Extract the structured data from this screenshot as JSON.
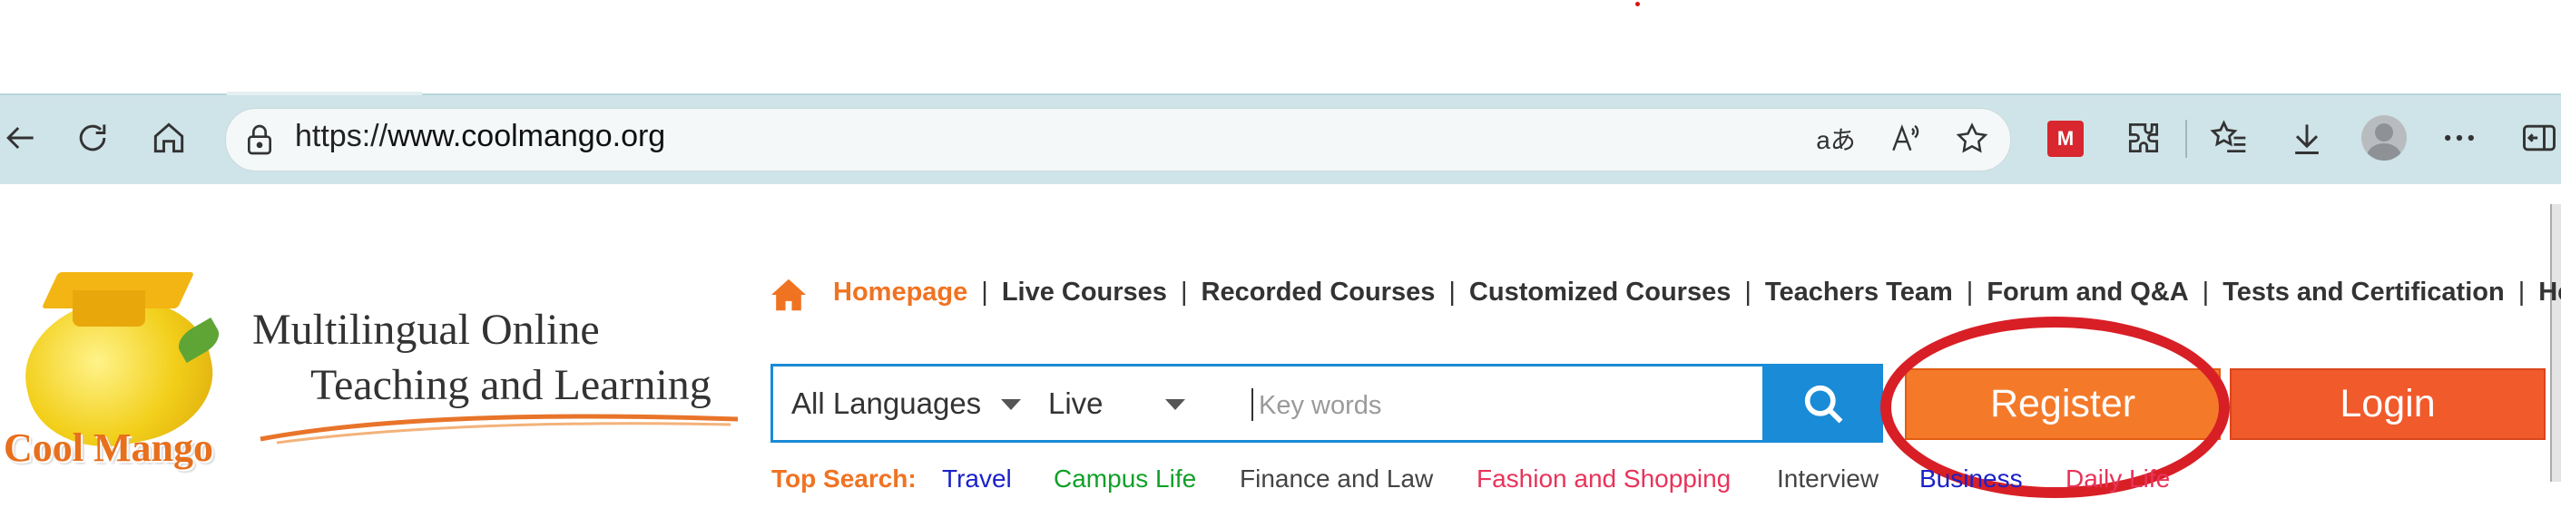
{
  "browser": {
    "url_prefix": "https://",
    "url_domain": "www.coolmango.org",
    "icons": [
      "back-icon",
      "refresh-icon",
      "home-icon",
      "lock-icon",
      "translate-icon",
      "read-aloud-icon",
      "favorite-star-icon",
      "mendeley-extension-icon",
      "extensions-icon",
      "favorites-icon",
      "downloads-icon",
      "profile-avatar",
      "more-icon",
      "sidebar-icon"
    ],
    "translate_glyph": "aあ",
    "read_aloud_glyph": "Aʾ",
    "mendeley_glyph": "M"
  },
  "logo": {
    "brand": "Cool Mango",
    "tagline_line1": "Multilingual Online",
    "tagline_line2": "Teaching and Learning"
  },
  "nav": {
    "items": [
      "Homepage",
      "Live Courses",
      "Recorded Courses",
      "Customized Courses",
      "Teachers Team",
      "Forum and Q&A",
      "Tests and Certification",
      "Help C"
    ],
    "separator": "|"
  },
  "search": {
    "language_select": "All Languages",
    "type_select": "Live",
    "placeholder": "Key words",
    "value": ""
  },
  "buttons": {
    "register": "Register",
    "login": "Login"
  },
  "top_search": {
    "label": "Top Search:",
    "items": [
      {
        "text": "Travel",
        "color": "#1b22c8"
      },
      {
        "text": "Campus Life",
        "color": "#12a02a"
      },
      {
        "text": "Finance and Law",
        "color": "#444444"
      },
      {
        "text": "Fashion and Shopping",
        "color": "#e8335a"
      },
      {
        "text": "Interview",
        "color": "#444444"
      },
      {
        "text": "Business",
        "color": "#1b22c8"
      },
      {
        "text": "Daily Life",
        "color": "#e8335a"
      }
    ]
  },
  "colors": {
    "accent_orange": "#f07322",
    "search_blue": "#1a8bd6",
    "annotation_red": "#d81f26"
  }
}
